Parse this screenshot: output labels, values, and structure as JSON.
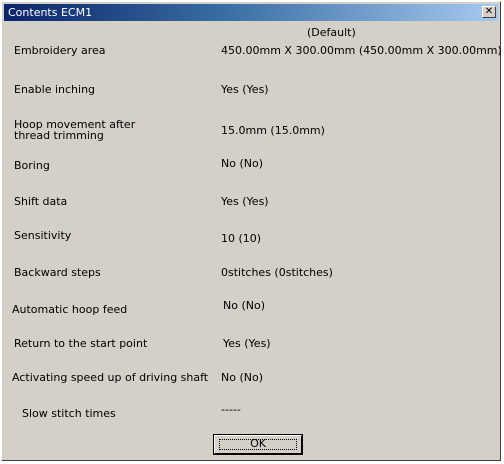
{
  "window": {
    "title": "Contents ECM1",
    "close_glyph": "✕"
  },
  "header": {
    "default_label": "(Default)"
  },
  "rows": [
    {
      "label": "Embroidery area",
      "value": "450.00mm X 300.00mm (450.00mm X 300.00mm)"
    },
    {
      "label": "Enable inching",
      "value": "Yes (Yes)"
    },
    {
      "label": "Hoop movement after thread trimming",
      "value": "15.0mm (15.0mm)"
    },
    {
      "label": "Boring",
      "value": "No (No)"
    },
    {
      "label": "Shift data",
      "value": "Yes (Yes)"
    },
    {
      "label": "Sensitivity",
      "value": "10 (10)"
    },
    {
      "label": "Backward steps",
      "value": "0stitches (0stitches)"
    },
    {
      "label": "Automatic hoop feed",
      "value": "No (No)"
    },
    {
      "label": "Return to the start point",
      "value": "Yes (Yes)"
    },
    {
      "label": "Activating speed up of driving shaft",
      "value": "No (No)"
    },
    {
      "label": "Slow stitch times",
      "value": "-----"
    }
  ],
  "buttons": {
    "ok_label": "OK"
  }
}
